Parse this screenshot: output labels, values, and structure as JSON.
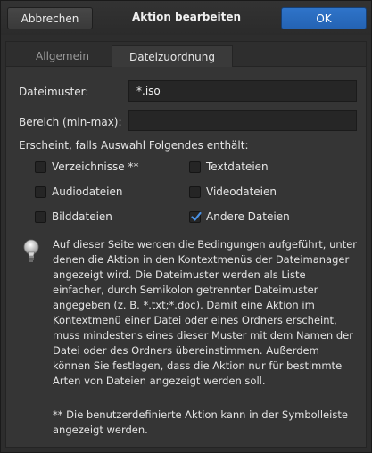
{
  "dialog": {
    "title": "Aktion bearbeiten",
    "cancel_label": "Abbrechen",
    "ok_label": "OK"
  },
  "tabs": [
    {
      "label": "Allgemein",
      "active": false
    },
    {
      "label": "Dateizuordnung",
      "active": true
    }
  ],
  "fields": {
    "pattern_label": "Dateimuster:",
    "pattern_value": "*.iso",
    "range_label": "Bereich (min-max):",
    "range_value": ""
  },
  "appears_label": "Erscheint, falls Auswahl Folgendes enthält:",
  "checkboxes": [
    {
      "label": "Verzeichnisse **",
      "checked": false
    },
    {
      "label": "Textdateien",
      "checked": false
    },
    {
      "label": "Audiodateien",
      "checked": false
    },
    {
      "label": "Videodateien",
      "checked": false
    },
    {
      "label": "Bilddateien",
      "checked": false
    },
    {
      "label": "Andere Dateien",
      "checked": true
    }
  ],
  "info": {
    "icon": "lightbulb-icon",
    "text": "Auf dieser Seite werden die Bedingungen aufgeführt, unter denen die Aktion in den Kontextmenüs der Dateimanager angezeigt wird. Die Dateimuster werden als Liste einfacher, durch Semikolon getrennter Dateimuster angegeben (z. B. *.txt;*.doc). Damit eine Aktion im Kontextmenü einer Datei oder eines Ordners erscheint, muss mindestens eines dieser Muster mit dem Namen der Datei oder des Ordners übereinstimmen. Außerdem können Sie festlegen, dass die Aktion nur für bestimmte Arten von Dateien angezeigt werden soll.",
    "footnote": "** Die benutzerdefinierte Aktion kann in der Symbolleiste angezeigt werden."
  },
  "colors": {
    "accent": "#2463b4",
    "background": "#2d2d2d",
    "panel": "#353535"
  }
}
